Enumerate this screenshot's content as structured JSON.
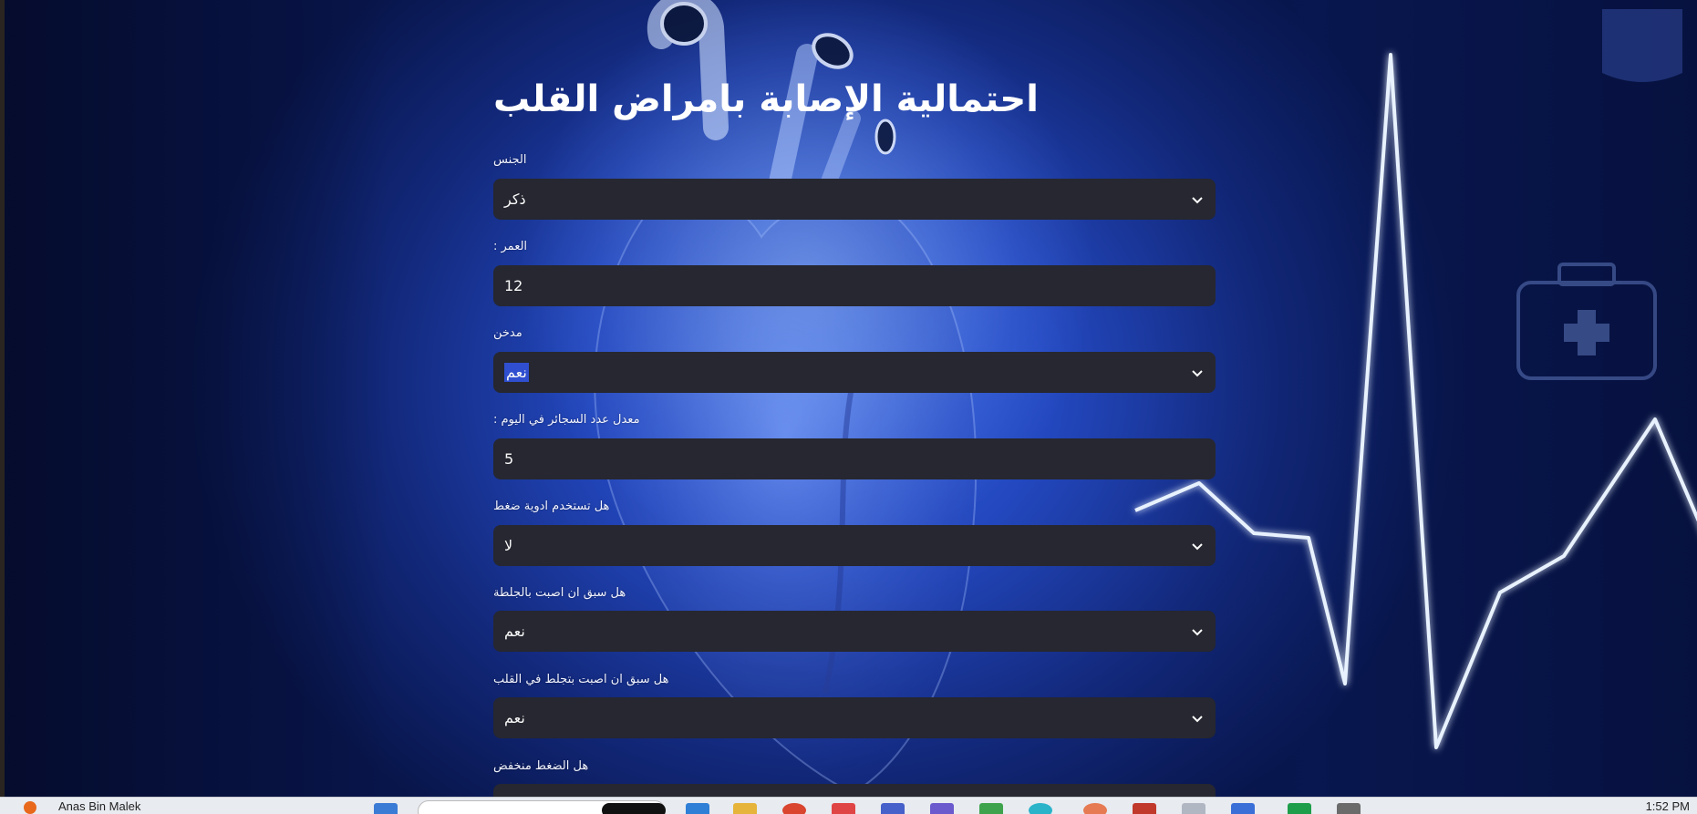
{
  "form": {
    "title": "احتمالية الإصابة بامراض القلب",
    "fields": [
      {
        "label": "الجنس",
        "type": "select",
        "value": "ذكر"
      },
      {
        "label": "العمر :",
        "type": "number",
        "value": "12"
      },
      {
        "label": "مدخن",
        "type": "select",
        "value": "نعم"
      },
      {
        "label": "معدل عدد السجائر في اليوم :",
        "type": "number",
        "value": "5"
      },
      {
        "label": "هل تستخدم ادوية ضغط",
        "type": "select",
        "value": "لا"
      },
      {
        "label": "هل سبق ان اصبت بالجلطة",
        "type": "select",
        "value": "نعم"
      },
      {
        "label": "هل سبق ان اصبت بتجلط في القلب",
        "type": "select",
        "value": "نعم"
      },
      {
        "label": "هل الضغط منخفض",
        "type": "select",
        "value": ""
      }
    ]
  },
  "taskbar": {
    "user": "Anas Bin Malek",
    "time": "1:52 PM"
  },
  "colors": {
    "control_bg": "#262730",
    "text": "#fafafa",
    "accent_highlight": "#2f4fd0"
  },
  "icons": {
    "select": "chevron-down-icon"
  }
}
